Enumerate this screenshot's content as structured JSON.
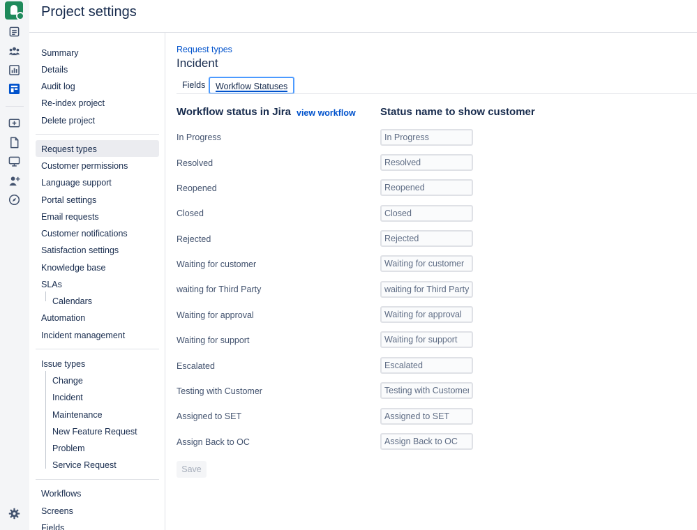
{
  "app": {
    "title": "Project settings",
    "rail_icons": [
      "project-logo",
      "issues-icon",
      "customers-icon",
      "reports-icon",
      "queues-icon",
      "raise-request-icon",
      "page-icon",
      "monitor-icon",
      "add-people-icon",
      "compass-icon",
      "gear-icon"
    ]
  },
  "sidebar": {
    "group1": [
      "Summary",
      "Details",
      "Audit log",
      "Re-index project",
      "Delete project"
    ],
    "group2": [
      "Request types",
      "Customer permissions",
      "Language support",
      "Portal settings",
      "Email requests",
      "Customer notifications",
      "Satisfaction settings",
      "Knowledge base",
      "SLAs"
    ],
    "sla_children": [
      "Calendars"
    ],
    "group2_tail": [
      "Automation",
      "Incident management"
    ],
    "issue_types_label": "Issue types",
    "issue_types": [
      "Change",
      "Incident",
      "Maintenance",
      "New Feature Request",
      "Problem",
      "Service Request"
    ],
    "group4": [
      "Workflows",
      "Screens",
      "Fields"
    ],
    "active_item": "Request types"
  },
  "main": {
    "breadcrumb": "Request types",
    "heading": "Incident",
    "tabs": [
      {
        "label": "Fields",
        "active": false
      },
      {
        "label": "Workflow Statuses",
        "active": true
      }
    ],
    "col_left_header": "Workflow status in Jira",
    "view_workflow_link": "view workflow",
    "col_right_header": "Status name to show customer",
    "statuses": [
      {
        "jira": "In Progress",
        "customer": "In Progress"
      },
      {
        "jira": "Resolved",
        "customer": "Resolved"
      },
      {
        "jira": "Reopened",
        "customer": "Reopened"
      },
      {
        "jira": "Closed",
        "customer": "Closed"
      },
      {
        "jira": "Rejected",
        "customer": "Rejected"
      },
      {
        "jira": "Waiting for customer",
        "customer": "Waiting for customer"
      },
      {
        "jira": "waiting for Third Party",
        "customer": "waiting for Third Party"
      },
      {
        "jira": "Waiting for approval",
        "customer": "Waiting for approval"
      },
      {
        "jira": "Waiting for support",
        "customer": "Waiting for support"
      },
      {
        "jira": "Escalated",
        "customer": "Escalated"
      },
      {
        "jira": "Testing with Customer",
        "customer": "Testing with Customer"
      },
      {
        "jira": "Assigned to SET",
        "customer": "Assigned to SET"
      },
      {
        "jira": "Assign Back to OC",
        "customer": "Assign Back to OC"
      }
    ],
    "save_label": "Save"
  },
  "colors": {
    "link": "#0052cc",
    "brand": "#1f8a5b",
    "focus": "#4c9aff"
  }
}
